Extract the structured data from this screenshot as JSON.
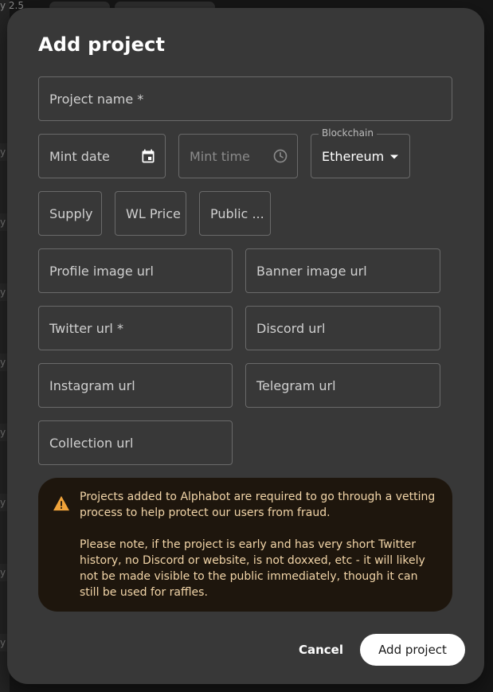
{
  "background": {
    "top_left_text": "y 2.5"
  },
  "modal": {
    "title": "Add project",
    "fields": {
      "project_name": "Project name *",
      "mint_date": "Mint date",
      "mint_time": "Mint time",
      "blockchain_label": "Blockchain",
      "blockchain_value": "Ethereum",
      "supply": "Supply",
      "wl_price": "WL Price",
      "public_price": "Public ...",
      "profile_image_url": "Profile image url",
      "banner_image_url": "Banner image url",
      "twitter_url": "Twitter url *",
      "discord_url": "Discord url",
      "instagram_url": "Instagram url",
      "telegram_url": "Telegram url",
      "collection_url": "Collection url"
    },
    "alert": {
      "paragraph1": "Projects added to Alphabot are required to go through a vetting process to help protect our users from fraud.",
      "paragraph2": "Please note, if the project is early and has very short Twitter history, no Discord or website, is not doxxed, etc - it will likely not be made visible to the public immediately, though it can still be used for raffles."
    },
    "buttons": {
      "cancel": "Cancel",
      "add": "Add project"
    }
  },
  "colors": {
    "modal_bg": "#383838",
    "alert_bg": "#1e160d",
    "alert_text": "#f2d5a8",
    "warning_icon": "#f0a33a",
    "primary_button_bg": "#ffffff"
  }
}
